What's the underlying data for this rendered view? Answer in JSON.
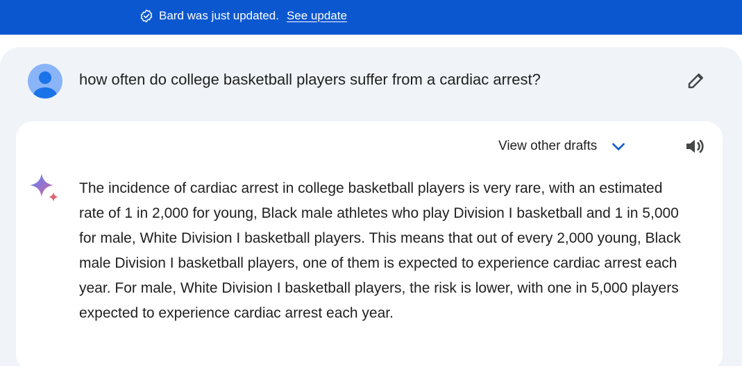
{
  "banner": {
    "message": "Bard was just updated.",
    "link_label": "See update"
  },
  "prompt": {
    "text": "how often do college basketball players suffer from a cardiac arrest?"
  },
  "response": {
    "drafts_label": "View other drafts",
    "text": "The incidence of cardiac arrest in college basketball players is very rare, with an estimated rate of 1 in 2,000 for young, Black male athletes who play Division I basketball and 1 in 5,000 for male, White Division I basketball players. This means that out of every 2,000 young, Black male Division I basketball players, one of them is expected to experience cardiac arrest each year. For male, White Division I basketball players, the risk is lower, with one in 5,000 players expected to experience cardiac arrest each year."
  },
  "icons": {
    "banner": "verified-check-icon",
    "avatar": "user-avatar-icon",
    "edit": "pencil-icon",
    "drafts": "chevron-down-icon",
    "speaker": "speaker-icon",
    "bard": "bard-sparkle-icon"
  },
  "colors": {
    "banner_bg": "#0b57d0",
    "chat_bg": "#f0f4f9",
    "card_bg": "#ffffff",
    "accent": "#0b57d0",
    "text": "#1f1f1f"
  }
}
